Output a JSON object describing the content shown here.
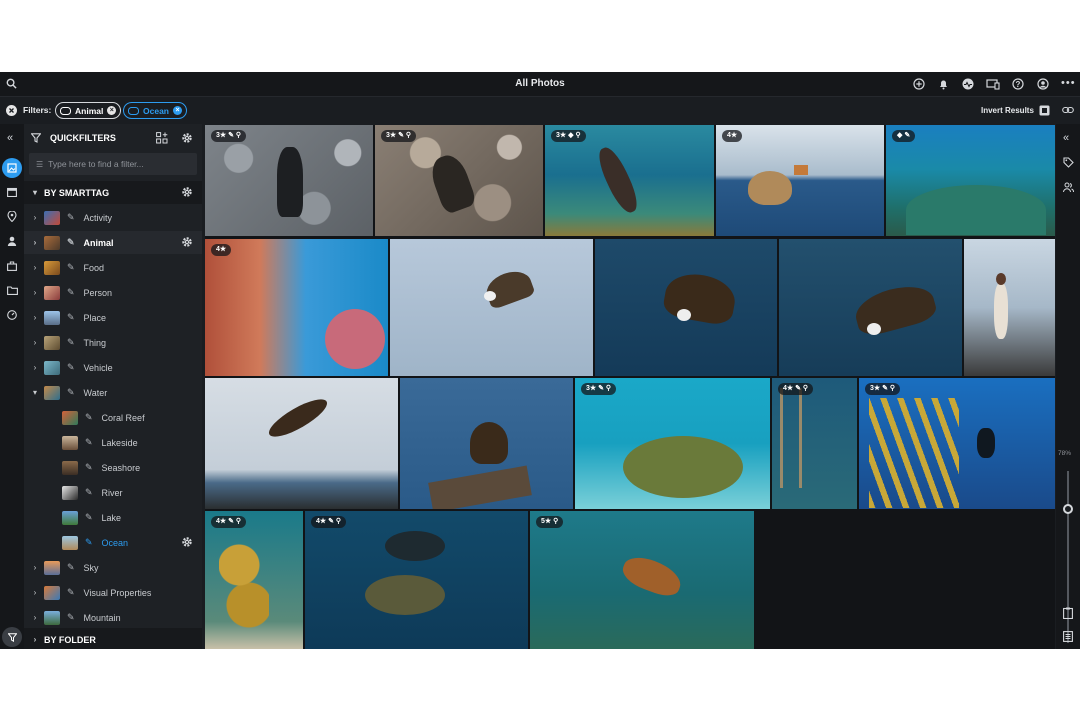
{
  "header": {
    "title": "All Photos"
  },
  "filters": {
    "label": "Filters:",
    "chips": [
      {
        "label": "Animal"
      },
      {
        "label": "Ocean"
      }
    ],
    "invert_label": "Invert Results"
  },
  "quickfilters": {
    "title": "QUICKFILTERS",
    "search_placeholder": "Type here to find a filter..."
  },
  "smarttag": {
    "title": "BY SMARTTAG",
    "items": [
      {
        "label": "Activity"
      },
      {
        "label": "Animal"
      },
      {
        "label": "Food"
      },
      {
        "label": "Person"
      },
      {
        "label": "Place"
      },
      {
        "label": "Thing"
      },
      {
        "label": "Vehicle"
      },
      {
        "label": "Water"
      }
    ],
    "water_children": [
      {
        "label": "Coral Reef"
      },
      {
        "label": "Lakeside"
      },
      {
        "label": "Seashore"
      },
      {
        "label": "River"
      },
      {
        "label": "Lake"
      },
      {
        "label": "Ocean"
      }
    ],
    "more_items": [
      {
        "label": "Sky"
      },
      {
        "label": "Visual Properties"
      },
      {
        "label": "Mountain"
      }
    ]
  },
  "folder": {
    "title": "BY FOLDER"
  },
  "zoom": {
    "label": "78%",
    "value": 0.78
  },
  "photos": [
    {
      "badge": "3★ ✎ ⚲"
    },
    {
      "badge": "3★ ✎ ⚲"
    },
    {
      "badge": "3★ ◆ ⚲"
    },
    {
      "badge": "4★"
    },
    {
      "badge": "◆ ✎"
    },
    {
      "badge": "4★"
    },
    {
      "badge": ""
    },
    {
      "badge": ""
    },
    {
      "badge": ""
    },
    {
      "badge": ""
    },
    {
      "badge": ""
    },
    {
      "badge": ""
    },
    {
      "badge": "3★ ✎ ⚲"
    },
    {
      "badge": "4★ ✎ ⚲"
    },
    {
      "badge": "3★ ✎ ⚲"
    },
    {
      "badge": "4★ ✎ ⚲"
    },
    {
      "badge": "4★ ✎ ⚲"
    },
    {
      "badge": "5★ ⚲"
    }
  ],
  "colors": {
    "accent": "#2d9cf0",
    "background": "#1a1d21",
    "sidebar": "#1e2125"
  }
}
